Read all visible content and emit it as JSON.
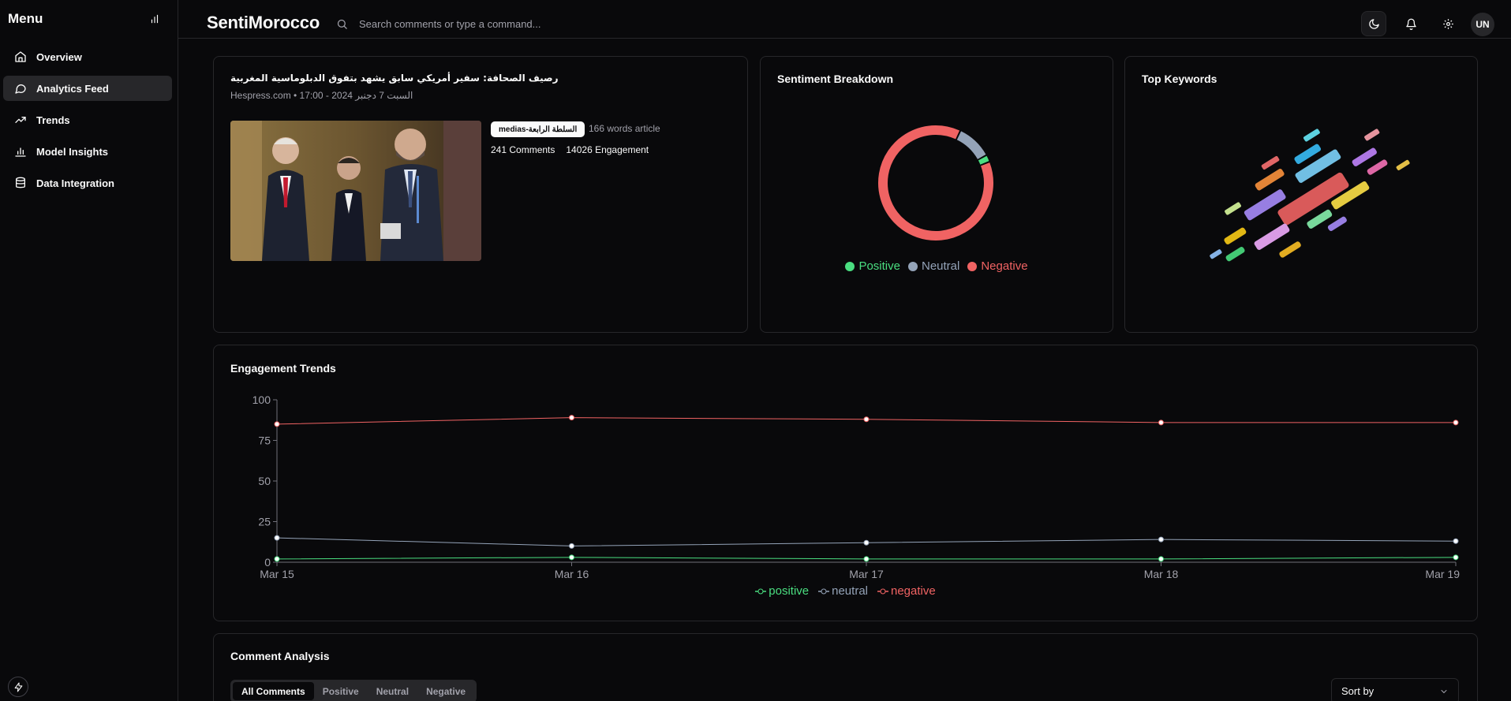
{
  "sidebar": {
    "title": "Menu",
    "items": [
      {
        "label": "Overview",
        "icon": "home-icon",
        "active": false
      },
      {
        "label": "Analytics Feed",
        "icon": "message-circle-icon",
        "active": true
      },
      {
        "label": "Trends",
        "icon": "trending-up-icon",
        "active": false
      },
      {
        "label": "Model Insights",
        "icon": "bar-chart-icon",
        "active": false
      },
      {
        "label": "Data Integration",
        "icon": "database-icon",
        "active": false
      }
    ]
  },
  "header": {
    "brand": "SentiMorocco",
    "search_placeholder": "Search comments or type a command...",
    "avatar": "UN"
  },
  "article": {
    "title": "رصيف الصحافة: سفير أمريكي سابق يشهد بتفوق الدبلوماسية المغربية",
    "meta": "Hespress.com • 17:00 - 2024 السبت 7 دجنبر",
    "tag": "medias-السلطة الرابعة",
    "words": "166 words article",
    "comments": "241 Comments",
    "engagement": "14026 Engagement"
  },
  "sentiment": {
    "title": "Sentiment Breakdown",
    "legend": [
      {
        "label": "Positive",
        "color": "#4ade80"
      },
      {
        "label": "Neutral",
        "color": "#94a3b8"
      },
      {
        "label": "Negative",
        "color": "#f06363"
      }
    ],
    "slices": [
      {
        "name": "Negative",
        "value": 88,
        "color": "#f06363"
      },
      {
        "name": "Neutral",
        "value": 10,
        "color": "#94a3b8"
      },
      {
        "name": "Positive",
        "value": 2,
        "color": "#4ade80"
      }
    ]
  },
  "keywords": {
    "title": "Top Keywords"
  },
  "trends": {
    "title": "Engagement Trends"
  },
  "comments_section": {
    "title": "Comment Analysis",
    "tabs": [
      "All Comments",
      "Positive",
      "Neutral",
      "Negative"
    ],
    "sort_label": "Sort by"
  },
  "chart_data": {
    "type": "line",
    "x": [
      "Mar 15",
      "Mar 16",
      "Mar 17",
      "Mar 18",
      "Mar 19"
    ],
    "ylim": [
      0,
      100
    ],
    "yticks": [
      0,
      25,
      50,
      75,
      100
    ],
    "grid": false,
    "legend_position": "bottom",
    "series": [
      {
        "name": "positive",
        "color": "#4ade80",
        "values": [
          2,
          3,
          2,
          2,
          3
        ]
      },
      {
        "name": "neutral",
        "color": "#94a3b8",
        "values": [
          15,
          10,
          12,
          14,
          13
        ]
      },
      {
        "name": "negative",
        "color": "#f06363",
        "values": [
          85,
          89,
          88,
          86,
          86
        ]
      }
    ]
  }
}
